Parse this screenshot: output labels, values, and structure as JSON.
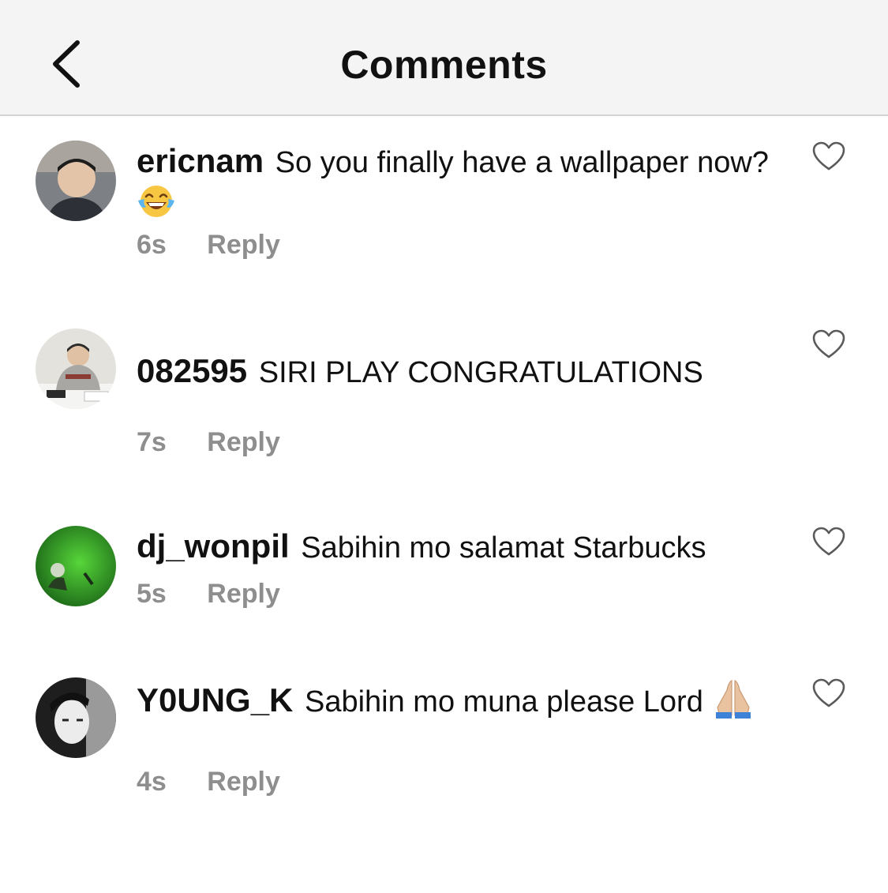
{
  "header": {
    "title": "Comments",
    "back_icon": "chevron-left-icon"
  },
  "comments": [
    {
      "username": "ericnam",
      "text": "So you finally have a wallpaper now?",
      "emoji": "face-with-tears-of-joy",
      "time": "6s",
      "reply_label": "Reply",
      "avatar_colors": [
        "#6b6f73",
        "#2a2c30"
      ]
    },
    {
      "username": "082595",
      "text": "SIRI PLAY CONGRATULATIONS",
      "time": "7s",
      "reply_label": "Reply",
      "avatar_colors": [
        "#d9d6d0",
        "#8c8478"
      ]
    },
    {
      "username": "dj_wonpil",
      "text": "Sabihin mo salamat Starbucks",
      "time": "5s",
      "reply_label": "Reply",
      "avatar_colors": [
        "#4fbf3a",
        "#1f5c1b"
      ]
    },
    {
      "username": "Y0UNG_K",
      "text": "Sabihin mo muna please Lord",
      "emoji": "folded-hands",
      "time": "4s",
      "reply_label": "Reply",
      "avatar_colors": [
        "#2b2b2b",
        "#e6e6e6"
      ]
    }
  ],
  "colors": {
    "header_bg": "#f4f4f4",
    "meta_gray": "#8e8e8e",
    "text": "#111111"
  }
}
